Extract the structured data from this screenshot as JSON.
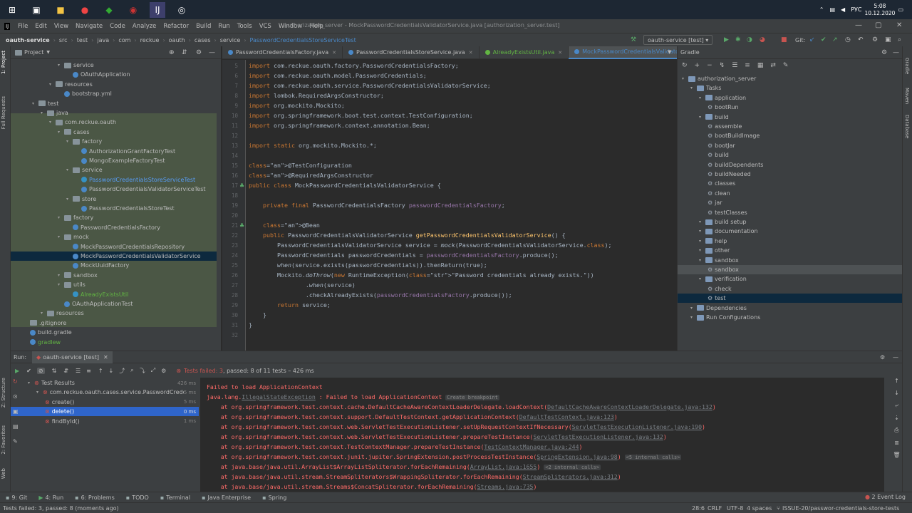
{
  "taskbar": {
    "tray": {
      "lang": "РУС",
      "time": "5:08",
      "date": "10.12.2020"
    }
  },
  "menu": {
    "items": [
      "File",
      "Edit",
      "View",
      "Navigate",
      "Code",
      "Analyze",
      "Refactor",
      "Build",
      "Run",
      "Tools",
      "VCS",
      "Window",
      "Help"
    ],
    "window_title": "authorization_server - MockPasswordCredentialsValidatorService.java [authorization_server.test]"
  },
  "navbar": {
    "crumbs": [
      "oauth-service",
      "src",
      "test",
      "java",
      "com",
      "reckue",
      "oauth",
      "cases",
      "service",
      "PasswordCredentialsStoreServiceTest"
    ],
    "run_config": "oauth-service [test]",
    "git_label": "Git:"
  },
  "project": {
    "title": "Project",
    "items": [
      {
        "label": "service",
        "indent": 5
      },
      {
        "label": "OAuthApplication",
        "indent": 6
      },
      {
        "label": "resources",
        "indent": 4
      },
      {
        "label": "bootstrap.yml",
        "indent": 5
      },
      {
        "label": "test",
        "indent": 2
      },
      {
        "label": "java",
        "indent": 3
      },
      {
        "label": "com.reckue.oauth",
        "indent": 4
      },
      {
        "label": "cases",
        "indent": 5
      },
      {
        "label": "factory",
        "indent": 6
      },
      {
        "label": "AuthorizationGrantFactoryTest",
        "indent": 7
      },
      {
        "label": "MongoExampleFactoryTest",
        "indent": 7
      },
      {
        "label": "service",
        "indent": 6
      },
      {
        "label": "PasswordCredentialsStoreServiceTest",
        "indent": 7
      },
      {
        "label": "PasswordCredentialsValidatorServiceTest",
        "indent": 7
      },
      {
        "label": "store",
        "indent": 6
      },
      {
        "label": "PasswordCredentialsStoreTest",
        "indent": 7
      },
      {
        "label": "factory",
        "indent": 5
      },
      {
        "label": "PasswordCredentialsFactory",
        "indent": 6
      },
      {
        "label": "mock",
        "indent": 5
      },
      {
        "label": "MockPasswordCredentialsRepository",
        "indent": 6
      },
      {
        "label": "MockPasswordCredentialsValidatorService",
        "indent": 6
      },
      {
        "label": "MockUuidFactory",
        "indent": 6
      },
      {
        "label": "sandbox",
        "indent": 5
      },
      {
        "label": "utils",
        "indent": 5
      },
      {
        "label": "AlreadyExistsUtil",
        "indent": 6
      },
      {
        "label": "OAuthApplicationTest",
        "indent": 5
      },
      {
        "label": "resources",
        "indent": 3
      },
      {
        "label": ".gitignore",
        "indent": 1
      },
      {
        "label": "build.gradle",
        "indent": 1
      },
      {
        "label": "gradlew",
        "indent": 1
      }
    ]
  },
  "editor": {
    "tabs": [
      "PasswordCredentialsFactory.java",
      "PasswordCredentialsStoreService.java",
      "AlreadyExistsUtil.java",
      "MockPasswordCredentialsValidatorService.java"
    ],
    "lines": [
      {
        "n": "5",
        "text": "import com.reckue.oauth.factory.PasswordCredentialsFactory;"
      },
      {
        "n": "6",
        "text": "import com.reckue.oauth.model.PasswordCredentials;"
      },
      {
        "n": "7",
        "text": "import com.reckue.oauth.service.PasswordCredentialsValidatorService;"
      },
      {
        "n": "8",
        "text": "import lombok.RequiredArgsConstructor;"
      },
      {
        "n": "9",
        "text": "import org.mockito.Mockito;"
      },
      {
        "n": "10",
        "text": "import org.springframework.boot.test.context.TestConfiguration;"
      },
      {
        "n": "11",
        "text": "import org.springframework.context.annotation.Bean;"
      },
      {
        "n": "12",
        "text": ""
      },
      {
        "n": "13",
        "text": "import static org.mockito.Mockito.*;"
      },
      {
        "n": "14",
        "text": ""
      },
      {
        "n": "15",
        "text": "@TestConfiguration"
      },
      {
        "n": "16",
        "text": "@RequiredArgsConstructor"
      },
      {
        "n": "17",
        "text": "public class MockPasswordCredentialsValidatorService {"
      },
      {
        "n": "18",
        "text": ""
      },
      {
        "n": "19",
        "text": "    private final PasswordCredentialsFactory passwordCredentialsFactory;"
      },
      {
        "n": "20",
        "text": ""
      },
      {
        "n": "21",
        "text": "    @Bean"
      },
      {
        "n": "22",
        "text": "    public PasswordCredentialsValidatorService getPasswordCredentialsValidatorService() {"
      },
      {
        "n": "23",
        "text": "        PasswordCredentialsValidatorService service = mock(PasswordCredentialsValidatorService.class);"
      },
      {
        "n": "24",
        "text": "        PasswordCredentials passwordCredentials = passwordCredentialsFactory.produce();"
      },
      {
        "n": "25",
        "text": "        when(service.exists(passwordCredentials)).thenReturn(true);"
      },
      {
        "n": "26",
        "text": "        Mockito.doThrow(new RuntimeException(\"Password credentials already exists.\"))"
      },
      {
        "n": "27",
        "text": "                .when(service)"
      },
      {
        "n": "28",
        "text": "                .checkAlreadyExists(passwordCredentialsFactory.produce());"
      },
      {
        "n": "29",
        "text": "        return service;"
      },
      {
        "n": "30",
        "text": "    }"
      },
      {
        "n": "31",
        "text": "}"
      },
      {
        "n": "32",
        "text": ""
      }
    ]
  },
  "gradle": {
    "title": "Gradle",
    "items": [
      {
        "label": "authorization_server",
        "indent": 0,
        "kind": "folder"
      },
      {
        "label": "Tasks",
        "indent": 1,
        "kind": "folder"
      },
      {
        "label": "application",
        "indent": 2,
        "kind": "folder"
      },
      {
        "label": "bootRun",
        "indent": 3,
        "kind": "gear"
      },
      {
        "label": "build",
        "indent": 2,
        "kind": "folder"
      },
      {
        "label": "assemble",
        "indent": 3,
        "kind": "gear"
      },
      {
        "label": "bootBuildImage",
        "indent": 3,
        "kind": "gear"
      },
      {
        "label": "bootJar",
        "indent": 3,
        "kind": "gear"
      },
      {
        "label": "build",
        "indent": 3,
        "kind": "gear"
      },
      {
        "label": "buildDependents",
        "indent": 3,
        "kind": "gear"
      },
      {
        "label": "buildNeeded",
        "indent": 3,
        "kind": "gear"
      },
      {
        "label": "classes",
        "indent": 3,
        "kind": "gear"
      },
      {
        "label": "clean",
        "indent": 3,
        "kind": "gear"
      },
      {
        "label": "jar",
        "indent": 3,
        "kind": "gear"
      },
      {
        "label": "testClasses",
        "indent": 3,
        "kind": "gear"
      },
      {
        "label": "build setup",
        "indent": 2,
        "kind": "folder"
      },
      {
        "label": "documentation",
        "indent": 2,
        "kind": "folder"
      },
      {
        "label": "help",
        "indent": 2,
        "kind": "folder"
      },
      {
        "label": "other",
        "indent": 2,
        "kind": "folder"
      },
      {
        "label": "sandbox",
        "indent": 2,
        "kind": "folder"
      },
      {
        "label": "sandbox",
        "indent": 3,
        "kind": "gear"
      },
      {
        "label": "verification",
        "indent": 2,
        "kind": "folder"
      },
      {
        "label": "check",
        "indent": 3,
        "kind": "gear"
      },
      {
        "label": "test",
        "indent": 3,
        "kind": "gear"
      },
      {
        "label": "Dependencies",
        "indent": 1,
        "kind": "folder"
      },
      {
        "label": "Run Configurations",
        "indent": 1,
        "kind": "folder"
      }
    ]
  },
  "run": {
    "label": "Run:",
    "tab": "oauth-service [test]",
    "summary_failed": "Tests failed: 3",
    "summary_rest": ", passed: 8 of 11 tests – 426 ms",
    "tree": [
      {
        "label": "Test Results",
        "time": "426 ms",
        "indent": 0
      },
      {
        "label": "com.reckue.oauth.cases.service.PasswordCredentials",
        "time": "5 ms",
        "indent": 1
      },
      {
        "label": "create()",
        "time": "5 ms",
        "indent": 2
      },
      {
        "label": "delete()",
        "time": "0 ms",
        "indent": 2
      },
      {
        "label": "findById()",
        "time": "1 ms",
        "indent": 2
      }
    ],
    "console": [
      {
        "pre": "Failed to load ApplicationContext",
        "link": "",
        "post": "",
        "pill": ""
      },
      {
        "pre": "java.lang.",
        "link": "IllegalStateException",
        "post": " : Failed to load ApplicationContext",
        "pill": "Create breakpoint"
      },
      {
        "pre": "    at org.springframework.test.context.cache.DefaultCacheAwareContextLoaderDelegate.loadContext(",
        "link": "DefaultCacheAwareContextLoaderDelegate.java:132",
        "post": ")",
        "pill": ""
      },
      {
        "pre": "    at org.springframework.test.context.support.DefaultTestContext.getApplicationContext(",
        "link": "DefaultTestContext.java:123",
        "post": ")",
        "pill": ""
      },
      {
        "pre": "    at org.springframework.test.context.web.ServletTestExecutionListener.setUpRequestContextIfNecessary(",
        "link": "ServletTestExecutionListener.java:190",
        "post": ")",
        "pill": ""
      },
      {
        "pre": "    at org.springframework.test.context.web.ServletTestExecutionListener.prepareTestInstance(",
        "link": "ServletTestExecutionListener.java:132",
        "post": ")",
        "pill": ""
      },
      {
        "pre": "    at org.springframework.test.context.TestContextManager.prepareTestInstance(",
        "link": "TestContextManager.java:244",
        "post": ")",
        "pill": ""
      },
      {
        "pre": "    at org.springframework.test.context.junit.jupiter.SpringExtension.postProcessTestInstance(",
        "link": "SpringExtension.java:98",
        "post": ")",
        "pill": "<5 internal calls>"
      },
      {
        "pre": "    at java.base/java.util.ArrayList$ArrayListSpliterator.forEachRemaining(",
        "link": "ArrayList.java:1655",
        "post": ")",
        "pill": "<2 internal calls>"
      },
      {
        "pre": "    at java.base/java.util.stream.StreamSpliterators$WrappingSpliterator.forEachRemaining(",
        "link": "StreamSpliterators.java:312",
        "post": ")",
        "pill": ""
      },
      {
        "pre": "    at java.base/java.util.stream.Streams$ConcatSpliterator.forEachRemaining(",
        "link": "Streams.java:735",
        "post": ")",
        "pill": ""
      }
    ]
  },
  "bottom_tools": [
    "9: Git",
    "4: Run",
    "6: Problems",
    "TODO",
    "Terminal",
    "Java Enterprise",
    "Spring"
  ],
  "event_log": "2 Event Log",
  "status": {
    "message": "Tests failed: 3, passed: 8 (moments ago)",
    "position": "28:6",
    "line_sep": "CRLF",
    "encoding": "UTF-8",
    "indent": "4 spaces",
    "branch": "ISSUE-20/passwor-credentials-store-tests"
  },
  "left_vtabs": [
    "1: Project",
    "Full Requests",
    "Z: Structure",
    "2: Favorites",
    "Web"
  ],
  "right_vtabs": [
    "Gradle",
    "Maven",
    "Database"
  ],
  "colors": {
    "accent": "#4a88c7",
    "error": "#ff6b68",
    "selection": "#2f65ca",
    "test_band": "#4b5745"
  }
}
